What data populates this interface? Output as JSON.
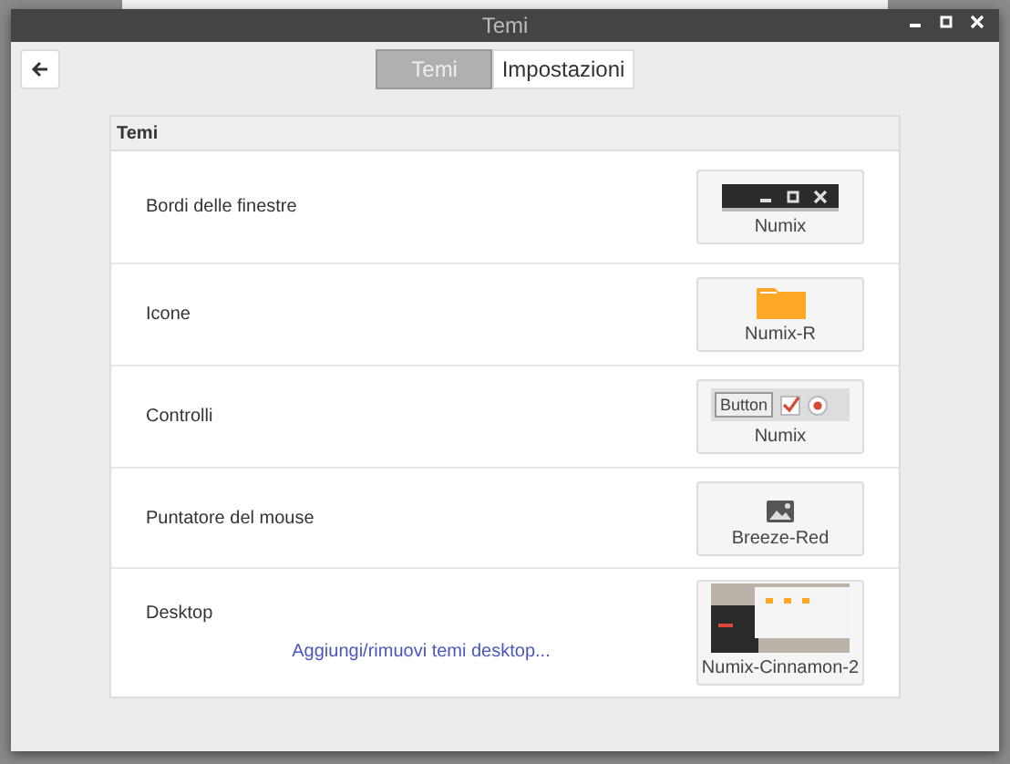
{
  "window": {
    "title": "Temi"
  },
  "tabs": [
    {
      "label": "Temi",
      "selected": true
    },
    {
      "label": "Impostazioni",
      "selected": false
    }
  ],
  "section": {
    "title": "Temi"
  },
  "rows": [
    {
      "label": "Bordi delle finestre",
      "kind": "window-controls",
      "theme": "Numix"
    },
    {
      "label": "Icone",
      "kind": "folder",
      "theme": "Numix-R"
    },
    {
      "label": "Controlli",
      "kind": "widgets",
      "theme": "Numix",
      "button_label": "Button"
    },
    {
      "label": "Puntatore del mouse",
      "kind": "image",
      "theme": "Breeze-Red"
    },
    {
      "label": "Desktop",
      "kind": "screenshot",
      "theme": "Numix-Cinnamon-2",
      "link": "Aggiungi/rimuovi temi desktop..."
    }
  ]
}
